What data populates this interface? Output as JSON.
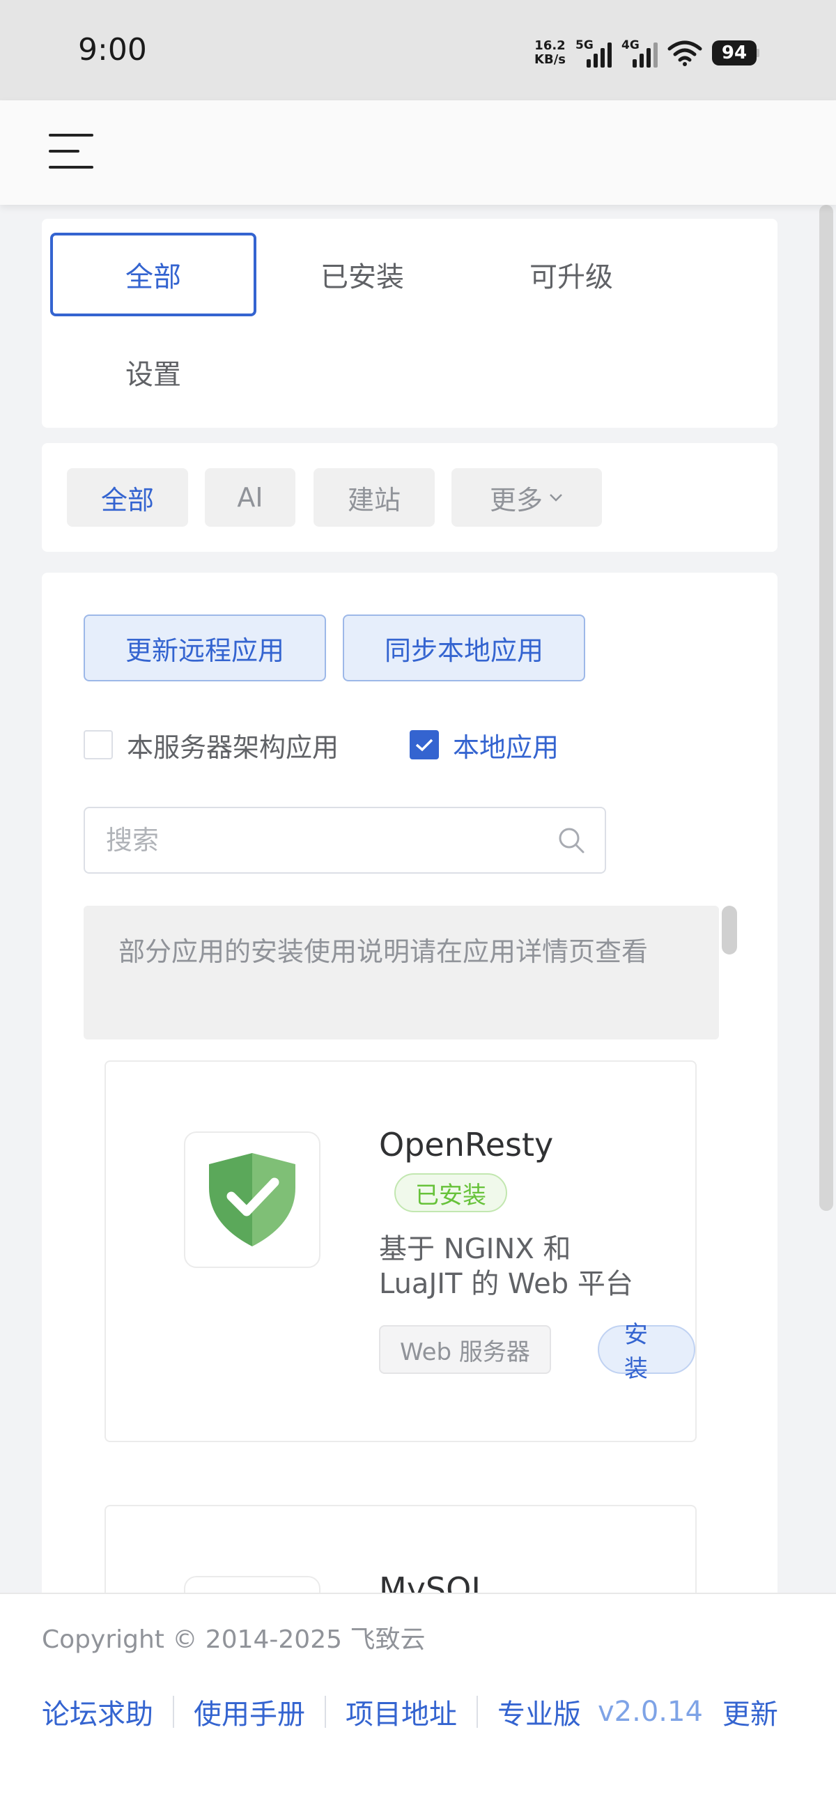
{
  "status_bar": {
    "time": "9:00",
    "net_speed_value": "16.2",
    "net_speed_unit": "KB/s",
    "signal1_label": "5G",
    "signal2_label": "4G",
    "battery": "94"
  },
  "tabs": [
    {
      "label": "全部",
      "active": true
    },
    {
      "label": "已安装",
      "active": false
    },
    {
      "label": "可升级",
      "active": false
    },
    {
      "label": "设置",
      "active": false
    }
  ],
  "filters": [
    {
      "label": "全部",
      "active": true
    },
    {
      "label": "AI",
      "active": false
    },
    {
      "label": "建站",
      "active": false
    },
    {
      "label": "更多",
      "active": false
    }
  ],
  "actions": {
    "update_remote": "更新远程应用",
    "sync_local": "同步本地应用"
  },
  "checkboxes": {
    "arch_label": "本服务器架构应用",
    "arch_checked": false,
    "local_label": "本地应用",
    "local_checked": true
  },
  "search": {
    "placeholder": "搜索",
    "value": ""
  },
  "notice": "部分应用的安装使用说明请在应用详情页查看",
  "apps": [
    {
      "name": "OpenResty",
      "status": "已安装",
      "description": "基于 NGINX 和 LuaJIT 的 Web 平台",
      "tag": "Web 服务器",
      "action": "安装",
      "icon": "shield-check-icon"
    },
    {
      "name": "MySQL",
      "icon": "mysql-icon"
    }
  ],
  "footer": {
    "copyright": "Copyright © 2014-2025 飞致云",
    "links": [
      "论坛求助",
      "使用手册",
      "项目地址",
      "专业版"
    ],
    "version": "v2.0.14",
    "update": "更新"
  },
  "colors": {
    "accent": "#3464d0",
    "success": "#67c23a",
    "muted": "#909399"
  }
}
